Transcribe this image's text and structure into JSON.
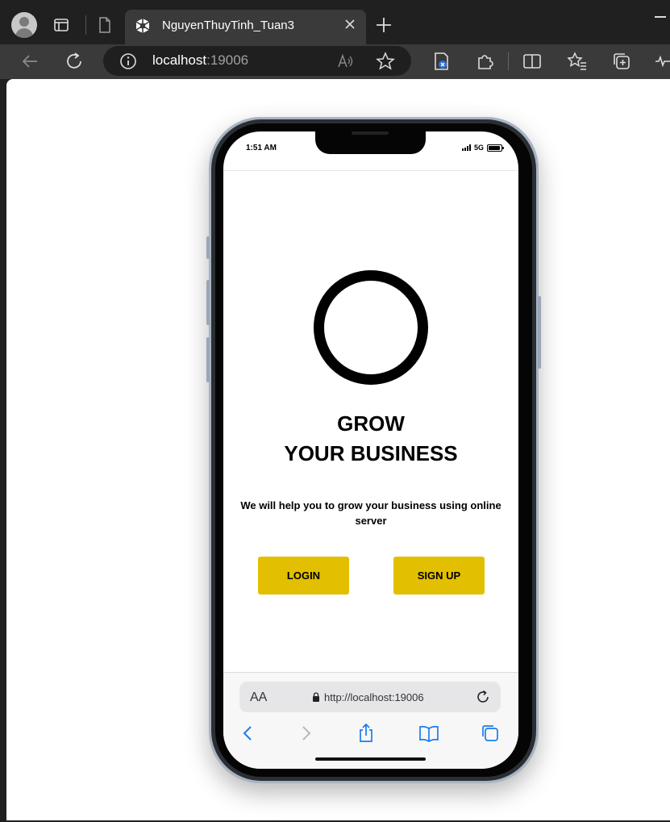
{
  "browser": {
    "tab_title": "NguyenThuyTinh_Tuan3",
    "url_host": "localhost",
    "url_port": ":19006",
    "accent": "#202020"
  },
  "phone": {
    "status": {
      "time": "1:51 AM",
      "network": "5G",
      "battery_level": 0.95
    },
    "app": {
      "headline_line1": "GROW",
      "headline_line2": "YOUR BUSINESS",
      "subtext": "We will help you to grow your business using online server",
      "login_label": "LOGIN",
      "signup_label": "SIGN UP",
      "button_color": "#e2bf00"
    },
    "safari": {
      "aa_label": "AA",
      "url": "http://localhost:19006"
    }
  }
}
